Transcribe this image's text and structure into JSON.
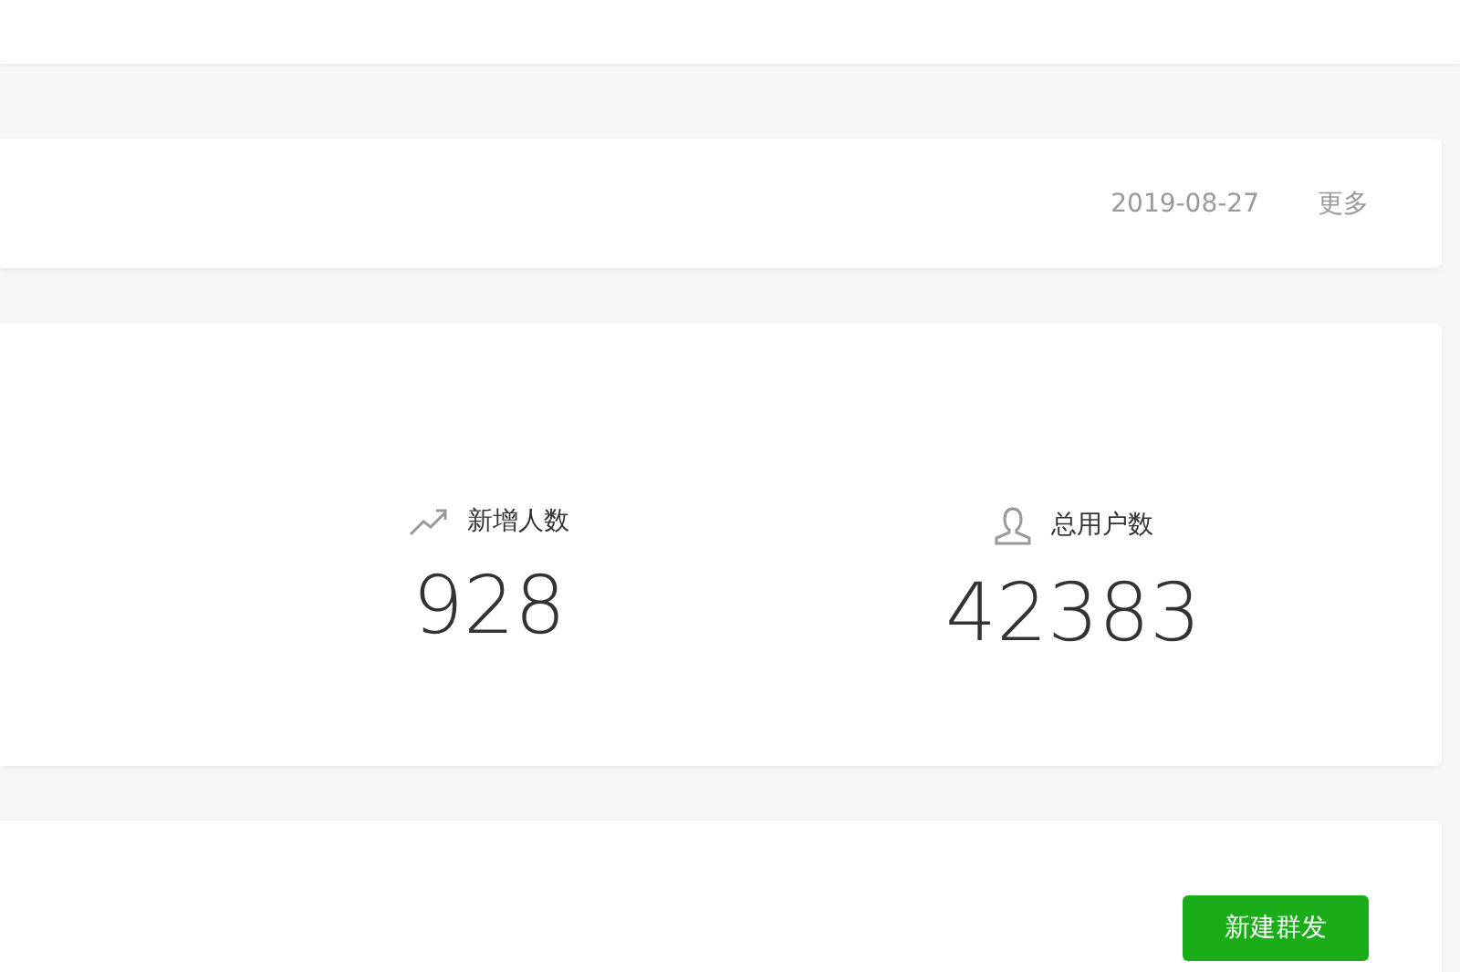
{
  "notice": {
    "date": "2019-08-27",
    "more_link": "更多"
  },
  "stats": [
    {
      "kind": "growth",
      "label": "新增人数",
      "value": "928"
    },
    {
      "kind": "users",
      "label": "总用户数",
      "value": "42383"
    }
  ],
  "broadcast": {
    "new_button": "新建群发"
  }
}
